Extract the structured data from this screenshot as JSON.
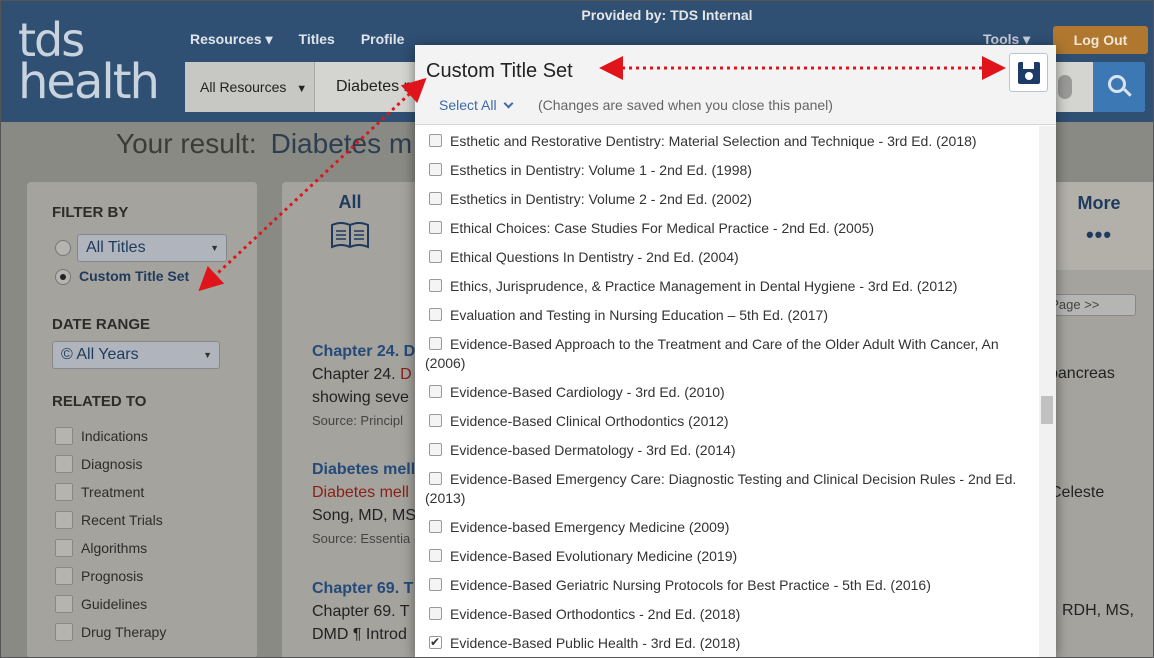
{
  "header": {
    "provided_by": "Provided by: TDS Internal",
    "logo_line1": "tds",
    "logo_line2": "health",
    "nav": [
      "Resources ▾",
      "Titles",
      "Profile"
    ],
    "tools": "Tools ▾",
    "logout": "Log Out",
    "resources_dropdown": "All Resources",
    "search_text": "Diabetes m"
  },
  "result": {
    "label": "Your result:",
    "query": "Diabetes m"
  },
  "sidebar": {
    "filter_by": "FILTER BY",
    "titles_dropdown": "All Titles",
    "custom_title_set": "Custom Title Set",
    "date_range": "DATE RANGE",
    "years_dropdown": "© All Years",
    "related_to": "RELATED TO",
    "related": [
      "Indications",
      "Diagnosis",
      "Treatment",
      "Recent Trials",
      "Algorithms",
      "Prognosis",
      "Guidelines",
      "Drug Therapy"
    ]
  },
  "content": {
    "tab_all": "All",
    "tab_more": "More",
    "tab_more_dots": "•••",
    "next_page": "t Page >>",
    "r1_title": "Chapter 24. D",
    "r1_line_a": "Chapter 24. ",
    "r1_line_a_red": "D",
    "r1_line_b": "showing seve",
    "r1_src": "Source: Principl",
    "r1_right": "pancreas",
    "r2_title": "Diabetes mell",
    "r2_red": "Diabetes mell",
    "r2_line_b": "Song, MD, MS",
    "r2_src": "Source: Essentia",
    "r2_right": "Celeste",
    "r3_title": "Chapter 69. T",
    "r3_line_a": "Chapter 69. T",
    "r3_line_b": "DMD ¶ Introd",
    "r3_right": "RDH, MS,"
  },
  "panel": {
    "title": "Custom Title Set",
    "select_all": "Select All",
    "note": "(Changes are saved when you close this panel)",
    "save_icon": "floppy-disk-icon",
    "items": [
      {
        "label": "Esthetic and Restorative Dentistry: Material Selection and Technique - 3rd Ed. (2018)",
        "checked": false
      },
      {
        "label": "Esthetics in Dentistry: Volume 1 - 2nd Ed. (1998)",
        "checked": false
      },
      {
        "label": "Esthetics in Dentistry: Volume 2 - 2nd Ed. (2002)",
        "checked": false
      },
      {
        "label": "Ethical Choices: Case Studies For Medical Practice - 2nd Ed. (2005)",
        "checked": false
      },
      {
        "label": "Ethical Questions In Dentistry - 2nd Ed. (2004)",
        "checked": false
      },
      {
        "label": "Ethics, Jurisprudence, & Practice Management in Dental Hygiene - 3rd Ed. (2012)",
        "checked": false
      },
      {
        "label": "Evaluation and Testing in Nursing Education – 5th Ed. (2017)",
        "checked": false
      },
      {
        "label": "Evidence-Based Approach to the Treatment and Care of the Older Adult With Cancer, An (2006)",
        "checked": false
      },
      {
        "label": "Evidence-Based Cardiology - 3rd Ed. (2010)",
        "checked": false
      },
      {
        "label": "Evidence-Based Clinical Orthodontics (2012)",
        "checked": false
      },
      {
        "label": "Evidence-based Dermatology - 3rd Ed. (2014)",
        "checked": false
      },
      {
        "label": "Evidence-Based Emergency Care: Diagnostic Testing and Clinical Decision Rules - 2nd Ed. (2013)",
        "checked": false
      },
      {
        "label": "Evidence-based Emergency Medicine (2009)",
        "checked": false
      },
      {
        "label": "Evidence-Based Evolutionary Medicine (2019)",
        "checked": false
      },
      {
        "label": "Evidence-Based Geriatric Nursing Protocols for Best Practice - 5th Ed. (2016)",
        "checked": false
      },
      {
        "label": "Evidence-Based Orthodontics - 2nd Ed. (2018)",
        "checked": false
      },
      {
        "label": "Evidence-Based Public Health - 3rd Ed. (2018)",
        "checked": true
      }
    ]
  },
  "colors": {
    "header_bg": "#2f4f73",
    "logout_bg": "#b0782f",
    "link_blue": "#244a79",
    "annotation_red": "#e0141b"
  }
}
